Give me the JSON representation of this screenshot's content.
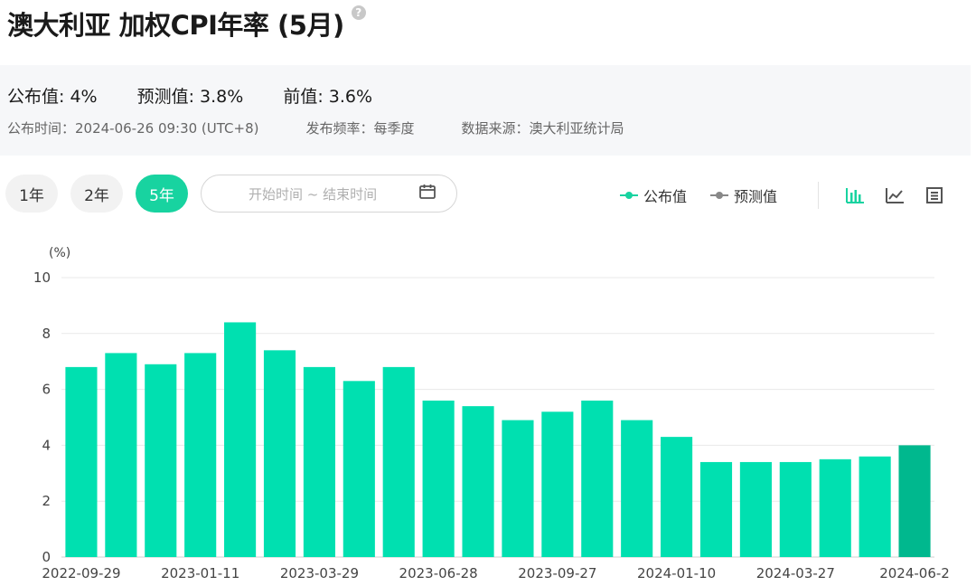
{
  "header": {
    "title": "澳大利亚 加权CPI年率 (5月)",
    "help_icon": "?"
  },
  "info": {
    "actual": "公布值: 4%",
    "forecast": "预测值: 3.8%",
    "previous": "前值: 3.6%",
    "release_time": "公布时间：2024-06-26 09:30 (UTC+8)",
    "frequency": "发布频率：每季度",
    "source": "数据来源：澳大利亚统计局"
  },
  "controls": {
    "range_1y": "1年",
    "range_2y": "2年",
    "range_5y": "5年",
    "date_placeholder": "开始时间 ~ 结束时间"
  },
  "legend": {
    "actual_label": "公布值",
    "forecast_label": "预测值"
  },
  "colors": {
    "bar": "#00e0b0",
    "bar_latest": "#00b88e",
    "accent": "#18d3a0",
    "forecast": "#888888",
    "grid": "#e9e9e9"
  },
  "chart_data": {
    "type": "bar",
    "ylabel": "(%)",
    "ylim": [
      0,
      10
    ],
    "yticks": [
      0,
      2,
      4,
      6,
      8,
      10
    ],
    "x_tick_labels": [
      "2022-09-29",
      "2023-01-11",
      "2023-03-29",
      "2023-06-28",
      "2023-09-27",
      "2024-01-10",
      "2024-03-27",
      "2024-06-2"
    ],
    "series": [
      {
        "values": [
          6.8,
          7.3,
          6.9,
          7.3,
          8.4,
          7.4,
          6.8,
          6.3,
          6.8,
          5.6,
          5.4,
          4.9,
          5.2,
          5.6,
          4.9,
          4.3,
          3.4,
          3.4,
          3.4,
          3.5,
          3.6,
          4.0
        ]
      }
    ],
    "highlight_last": true,
    "grid": true,
    "legend_position": "top-right"
  }
}
